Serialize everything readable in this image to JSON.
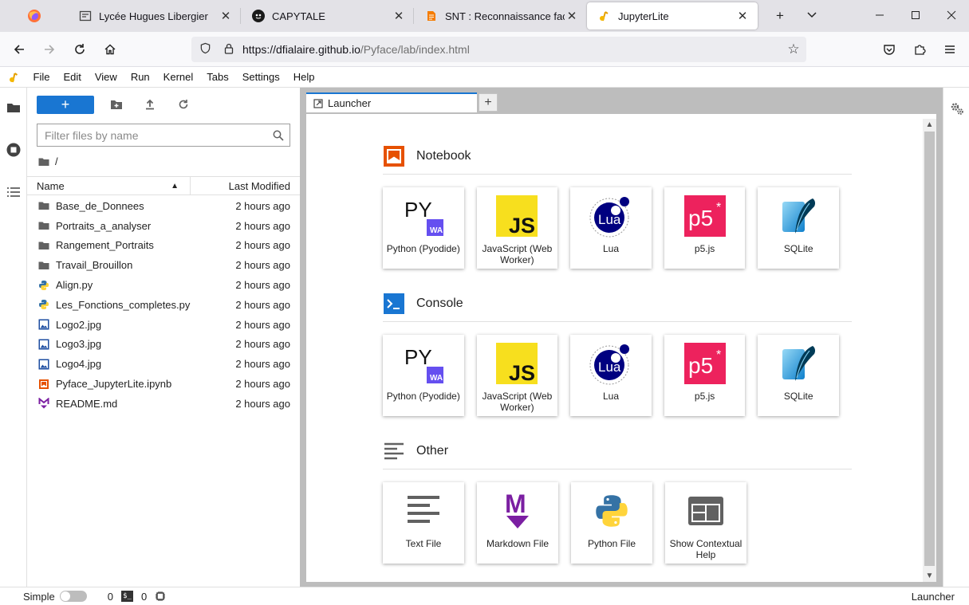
{
  "browser": {
    "tabs": [
      {
        "title": "Lycée Hugues Libergier",
        "active": false
      },
      {
        "title": "CAPYTALE",
        "active": false
      },
      {
        "title": "SNT : Reconnaissance faciale",
        "active": false
      },
      {
        "title": "JupyterLite",
        "active": true
      }
    ],
    "url_host": "https://dfialaire.github.io",
    "url_path": "/Pyface/lab/index.html"
  },
  "menu": [
    "File",
    "Edit",
    "View",
    "Run",
    "Kernel",
    "Tabs",
    "Settings",
    "Help"
  ],
  "filebrowser": {
    "filter_placeholder": "Filter files by name",
    "path": "/",
    "col_name": "Name",
    "col_modified": "Last Modified",
    "files": [
      {
        "name": "Base_de_Donnees",
        "type": "folder",
        "modified": "2 hours ago"
      },
      {
        "name": "Portraits_a_analyser",
        "type": "folder",
        "modified": "2 hours ago"
      },
      {
        "name": "Rangement_Portraits",
        "type": "folder",
        "modified": "2 hours ago"
      },
      {
        "name": "Travail_Brouillon",
        "type": "folder",
        "modified": "2 hours ago"
      },
      {
        "name": "Align.py",
        "type": "python",
        "modified": "2 hours ago"
      },
      {
        "name": "Les_Fonctions_completes.py",
        "type": "python",
        "modified": "2 hours ago"
      },
      {
        "name": "Logo2.jpg",
        "type": "image",
        "modified": "2 hours ago"
      },
      {
        "name": "Logo3.jpg",
        "type": "image",
        "modified": "2 hours ago"
      },
      {
        "name": "Logo4.jpg",
        "type": "image",
        "modified": "2 hours ago"
      },
      {
        "name": "Pyface_JupyterLite.ipynb",
        "type": "notebook",
        "modified": "2 hours ago"
      },
      {
        "name": "README.md",
        "type": "markdown",
        "modified": "2 hours ago"
      }
    ]
  },
  "dock": {
    "tab_label": "Launcher"
  },
  "launcher": {
    "notebook": {
      "title": "Notebook",
      "cards": [
        "Python (Pyodide)",
        "JavaScript (Web Worker)",
        "Lua",
        "p5.js",
        "SQLite"
      ]
    },
    "console": {
      "title": "Console",
      "cards": [
        "Python (Pyodide)",
        "JavaScript (Web Worker)",
        "Lua",
        "p5.js",
        "SQLite"
      ]
    },
    "other": {
      "title": "Other",
      "cards": [
        "Text File",
        "Markdown File",
        "Python File",
        "Show Contextual Help"
      ]
    },
    "icon_text": {
      "py": "PY",
      "wa": "WA",
      "js": "JS",
      "lua": "Lua",
      "p5": "p5",
      "md": "M"
    }
  },
  "status": {
    "mode_label": "Simple",
    "kernels": "0",
    "terminals": "0",
    "terminal_icon": "$_",
    "right_label": "Launcher"
  },
  "colors": {
    "accent": "#1976d2",
    "notebook_orange": "#e65100",
    "p5_pink": "#ed225d",
    "js_yellow": "#f7df1e",
    "lua_navy": "#000080"
  }
}
